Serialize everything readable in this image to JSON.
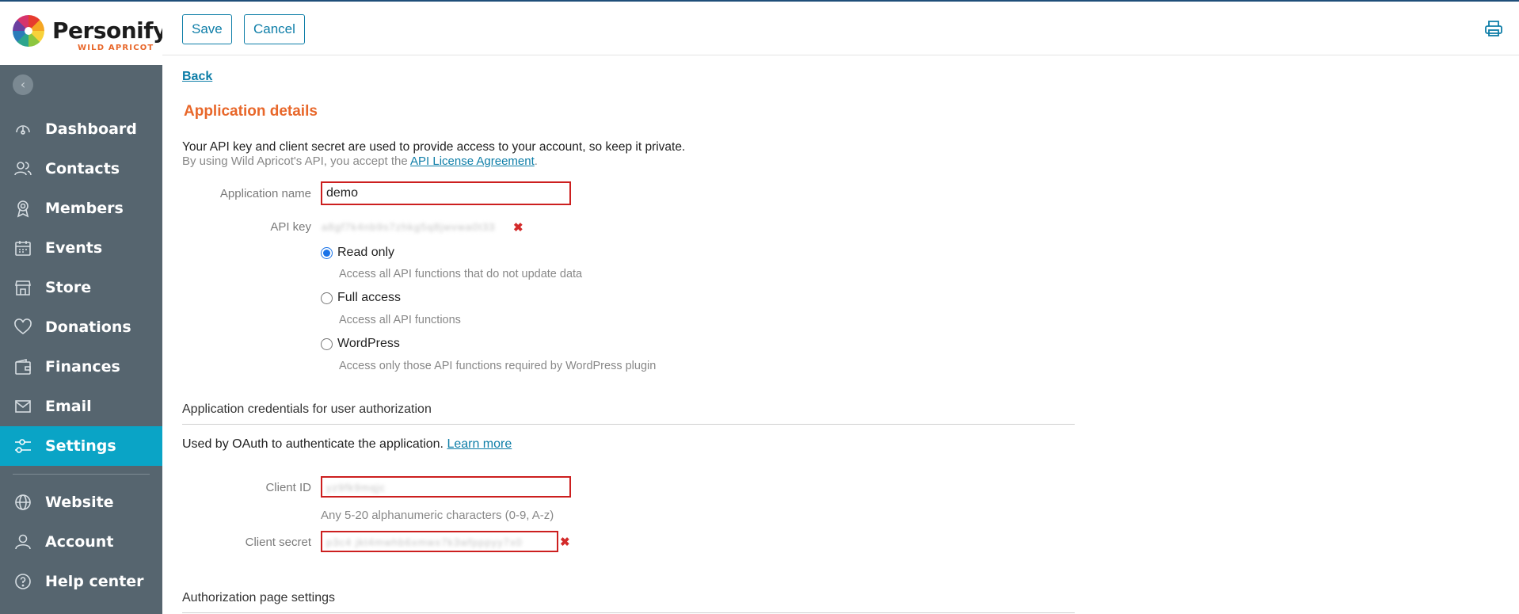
{
  "brand": {
    "name": "Personify",
    "sub": "WILD APRICOT",
    "colors": {
      "accent": "#e8672a",
      "link": "#0e7ea8",
      "sidebar": "#56656f",
      "active": "#0aa4c6"
    }
  },
  "sidebar": {
    "items": [
      {
        "label": "Dashboard",
        "icon": "dashboard-icon"
      },
      {
        "label": "Contacts",
        "icon": "contacts-icon"
      },
      {
        "label": "Members",
        "icon": "members-icon"
      },
      {
        "label": "Events",
        "icon": "calendar-icon"
      },
      {
        "label": "Store",
        "icon": "store-icon"
      },
      {
        "label": "Donations",
        "icon": "heart-icon"
      },
      {
        "label": "Finances",
        "icon": "wallet-icon"
      },
      {
        "label": "Email",
        "icon": "mail-icon"
      },
      {
        "label": "Settings",
        "icon": "settings-sliders-icon",
        "active": true
      },
      {
        "label": "Website",
        "icon": "globe-icon"
      },
      {
        "label": "Account",
        "icon": "user-icon"
      },
      {
        "label": "Help center",
        "icon": "help-icon"
      }
    ]
  },
  "toolbar": {
    "save_label": "Save",
    "cancel_label": "Cancel"
  },
  "page": {
    "back_label": "Back",
    "title": "Application details",
    "intro_line1": "Your API key and client secret are used to provide access to your account, so keep it private.",
    "intro_line2_prefix": "By using Wild Apricot's API, you accept the ",
    "intro_line2_link": "API License Agreement",
    "intro_line2_suffix": "."
  },
  "form": {
    "app_name_label": "Application name",
    "app_name_value": "demo",
    "api_key_label": "API key",
    "api_key_value": "a8gf7k4nb9s7zhkg5q8jwvwa0t33",
    "access_options": [
      {
        "label": "Read only",
        "desc": "Access all API functions that do not update data",
        "checked": true
      },
      {
        "label": "Full access",
        "desc": "Access all API functions",
        "checked": false
      },
      {
        "label": "WordPress",
        "desc": "Access only those API functions required by WordPress plugin",
        "checked": false
      }
    ]
  },
  "credentials": {
    "section_title": "Application credentials for user authorization",
    "desc": "Used by OAuth to authenticate the application. ",
    "learn_more": "Learn more",
    "client_id_label": "Client ID",
    "client_id_value": "yz9fk9mqjc",
    "client_id_hint": "Any 5-20 alphanumeric characters (0-9, A-z)",
    "client_secret_label": "Client secret",
    "client_secret_value": "p3c4 jkt4mwhb6xmwx7k3wfpppyy7x0"
  },
  "auth_page": {
    "section_title": "Authorization page settings"
  }
}
